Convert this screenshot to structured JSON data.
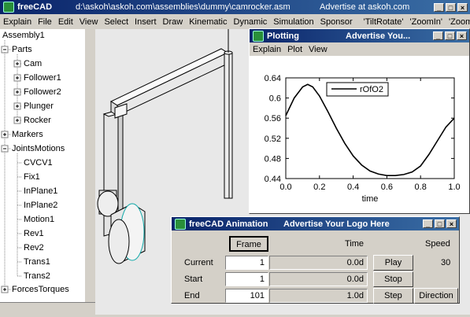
{
  "main_window": {
    "title": "freeCAD",
    "path": "d:\\askoh\\askoh.com\\assemblies\\dummy\\camrocker.asm",
    "advert": "Advertise at askoh.com",
    "menu": [
      "Explain",
      "File",
      "Edit",
      "View",
      "Select",
      "Insert",
      "Draw",
      "Kinematic",
      "Dynamic",
      "Simulation",
      "Sponsor",
      "'TiltRotate'",
      "'ZoomIn'",
      "'ZoomOut'"
    ]
  },
  "tree": {
    "nodes": [
      {
        "label": "Assembly1"
      },
      {
        "label": "Parts"
      },
      {
        "label": "Cam"
      },
      {
        "label": "Follower1"
      },
      {
        "label": "Follower2"
      },
      {
        "label": "Plunger"
      },
      {
        "label": "Rocker"
      },
      {
        "label": "Markers"
      },
      {
        "label": "JointsMotions"
      },
      {
        "label": "CVCV1"
      },
      {
        "label": "Fix1"
      },
      {
        "label": "InPlane1"
      },
      {
        "label": "InPlane2"
      },
      {
        "label": "Motion1"
      },
      {
        "label": "Rev1"
      },
      {
        "label": "Rev2"
      },
      {
        "label": "Trans1"
      },
      {
        "label": "Trans2"
      },
      {
        "label": "ForcesTorques"
      }
    ]
  },
  "plot_window": {
    "title": "Plotting",
    "advert": "Advertise You...",
    "menu": [
      "Explain",
      "Plot",
      "View"
    ]
  },
  "chart_data": {
    "type": "line",
    "xlabel": "time",
    "ylabel": "",
    "xlim": [
      0.0,
      1.0
    ],
    "ylim": [
      0.44,
      0.64
    ],
    "xticks": [
      "0.0",
      "0.2",
      "0.4",
      "0.6",
      "0.8",
      "1.0"
    ],
    "yticks": [
      "0.64",
      "0.6",
      "0.56",
      "0.52",
      "0.48",
      "0.44"
    ],
    "legend_position": "top-center",
    "series": [
      {
        "name": "rOfO2",
        "color": "#000000",
        "x": [
          0.0,
          0.05,
          0.1,
          0.13,
          0.16,
          0.2,
          0.25,
          0.3,
          0.35,
          0.4,
          0.45,
          0.5,
          0.55,
          0.6,
          0.65,
          0.7,
          0.75,
          0.8,
          0.85,
          0.9,
          0.95,
          1.0
        ],
        "y": [
          0.565,
          0.6,
          0.622,
          0.627,
          0.622,
          0.604,
          0.573,
          0.54,
          0.51,
          0.485,
          0.467,
          0.455,
          0.449,
          0.446,
          0.446,
          0.448,
          0.453,
          0.465,
          0.488,
          0.515,
          0.542,
          0.56
        ]
      }
    ]
  },
  "anim_window": {
    "title": "freeCAD Animation",
    "advert": "Advertise Your Logo Here",
    "frame_button": "Frame",
    "time_header": "Time",
    "speed_header": "Speed",
    "speed_value": "30",
    "rows": [
      {
        "label": "Current",
        "frame": "1",
        "time": "0.0d",
        "button": "Play"
      },
      {
        "label": "Start",
        "frame": "1",
        "time": "0.0d",
        "button": "Stop"
      },
      {
        "label": "End",
        "frame": "101",
        "time": "1.0d",
        "button": "Step"
      }
    ],
    "direction_button": "Direction"
  }
}
